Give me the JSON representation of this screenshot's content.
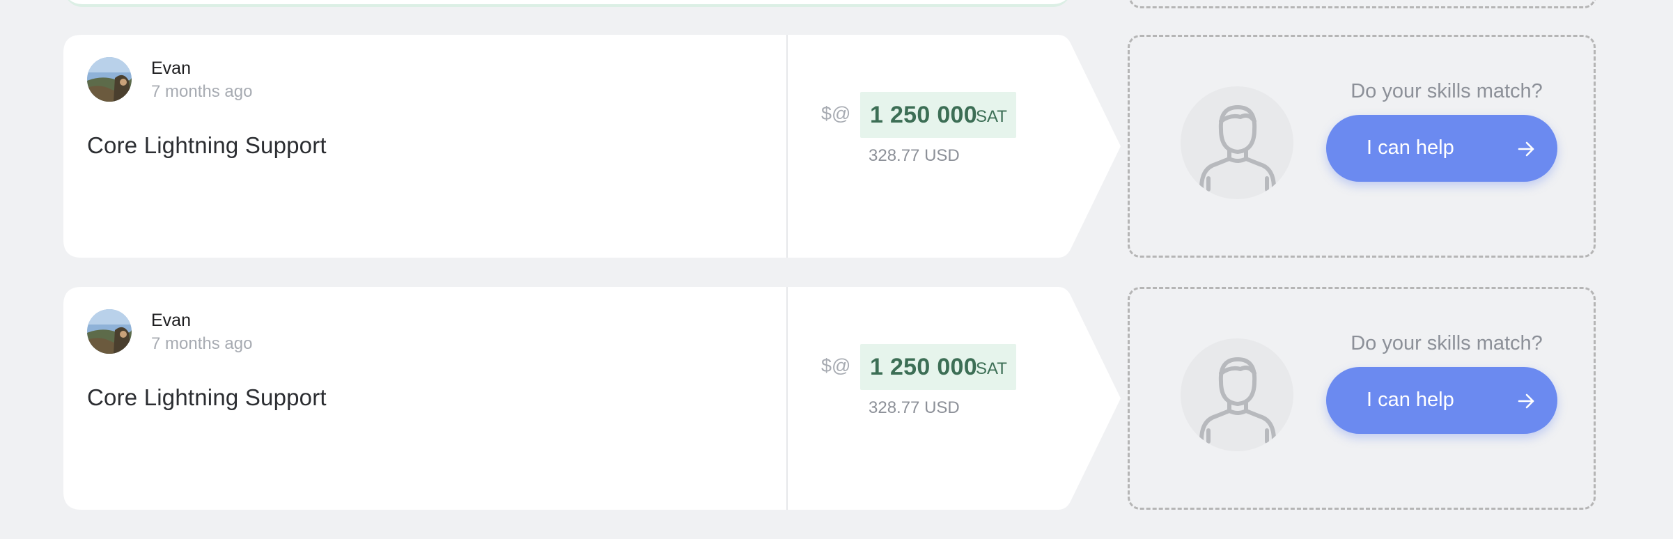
{
  "colors": {
    "background": "#f0f1f3",
    "card": "#ffffff",
    "sat_badge_bg": "#e6f4ec",
    "sat_text": "#3c6e55",
    "button": "#6b8af0",
    "muted_text": "#8c9098"
  },
  "bounties": [
    {
      "author": "Evan",
      "posted": "7 months ago",
      "title": "Core Lightning Support",
      "currency_icon": "$@",
      "amount_sat": "1 250 000",
      "unit": "SAT",
      "amount_usd": "328.77 USD",
      "match_prompt": "Do your skills match?",
      "help_label": "I can help",
      "icons": [
        "avatar-photo",
        "user-placeholder-icon",
        "arrow-right-icon"
      ]
    },
    {
      "author": "Evan",
      "posted": "7 months ago",
      "title": "Core Lightning Support",
      "currency_icon": "$@",
      "amount_sat": "1 250 000",
      "unit": "SAT",
      "amount_usd": "328.77 USD",
      "match_prompt": "Do your skills match?",
      "help_label": "I can help",
      "icons": [
        "avatar-photo",
        "user-placeholder-icon",
        "arrow-right-icon"
      ]
    }
  ]
}
